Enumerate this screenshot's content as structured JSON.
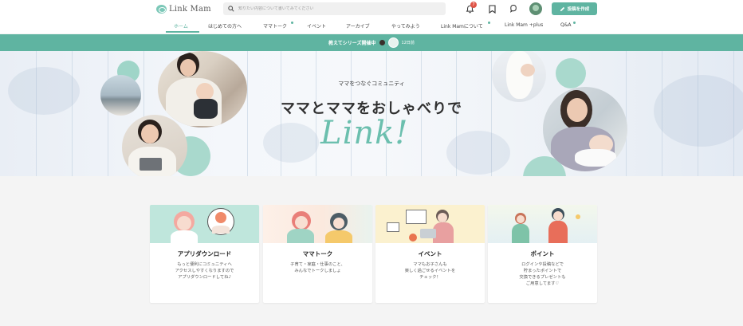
{
  "header": {
    "logo_text": "Link Mam",
    "search_placeholder": "知りたい内容について書いてみてください",
    "notification_count": "7",
    "post_button_label": "投稿を作成"
  },
  "nav": {
    "items": [
      {
        "label": "ホーム",
        "active": true
      },
      {
        "label": "はじめての方へ"
      },
      {
        "label": "ママトーク",
        "dot": true
      },
      {
        "label": "イベント"
      },
      {
        "label": "アーカイブ"
      },
      {
        "label": "やってみよう"
      },
      {
        "label": "Link Mamについて",
        "dot": true
      },
      {
        "label": "Link Mam +plus"
      },
      {
        "label": "Q&A",
        "dot": true
      }
    ]
  },
  "announcement": {
    "text": "教えてシリーズ開催中",
    "time": "12日前"
  },
  "hero": {
    "subtitle": "ママをつなぐコミュニティ",
    "title": "ママとママをおしゃべりで",
    "script": "Link!"
  },
  "cards": [
    {
      "title": "アプリダウンロード",
      "desc": "もっと便利にコミュニティへ\nアクセスしやすくなりますので\nアプリダウンロードしてね♪"
    },
    {
      "title": "ママトーク",
      "desc": "子育て・家庭・仕事のこと、\nみんなでトークしましょ"
    },
    {
      "title": "イベント",
      "desc": "ママもお子さんも\n楽しく過ごせるイベントを\nチェック！"
    },
    {
      "title": "ポイント",
      "desc": "ログインや投稿などで\n貯まったポイントで\n交換できるプレゼントも\nご用意してます♡"
    }
  ],
  "colors": {
    "accent": "#5fb4a1",
    "badge": "#e05548",
    "background": "#f4f4f4"
  }
}
